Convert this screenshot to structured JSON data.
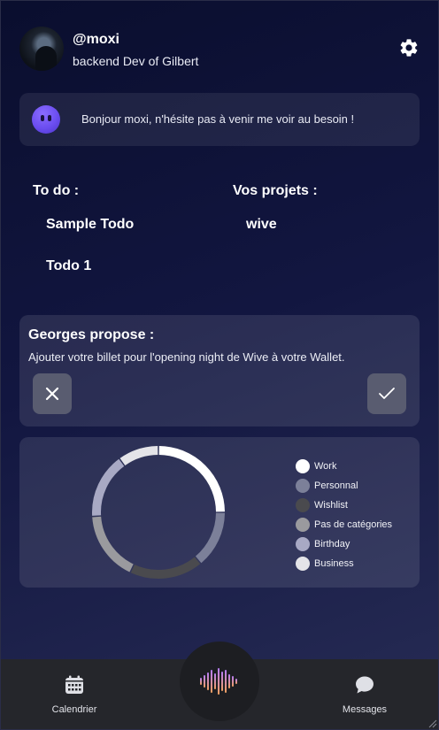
{
  "profile": {
    "username": "@moxi",
    "subtitle": "backend Dev of Gilbert",
    "avatar_icon": "avatar-photo",
    "settings_icon": "gear-icon"
  },
  "greeting": {
    "icon": "bot-avatar-icon",
    "text": "Bonjour moxi, n'hésite pas à venir me voir au besoin !"
  },
  "todo": {
    "title": "To do :",
    "items": [
      "Sample Todo",
      "Todo 1"
    ]
  },
  "projects": {
    "title": "Vos projets :",
    "items": [
      "wive"
    ]
  },
  "proposal": {
    "title": "Georges propose :",
    "text": "Ajouter votre billet pour l'opening night de Wive à votre Wallet.",
    "reject_icon": "close-icon",
    "accept_icon": "check-icon"
  },
  "chart_data": {
    "type": "pie",
    "variant": "donut",
    "categories": [
      "Work",
      "Personnal",
      "Wishlist",
      "Pas de catégories",
      "Birthday",
      "Business"
    ],
    "values": [
      25,
      14,
      18,
      17,
      16,
      10
    ],
    "colors": [
      "#ffffff",
      "#7c8099",
      "#4a4a4e",
      "#9a9a9e",
      "#a8a9c4",
      "#e4e4e8"
    ],
    "legend_position": "right"
  },
  "nav": {
    "calendar_label": "Calendrier",
    "messages_label": "Messages",
    "calendar_icon": "calendar-icon",
    "messages_icon": "chat-bubble-icon",
    "center_icon": "sound-wave-icon"
  },
  "colors": {
    "background": "#121640",
    "card": "#ffffff1a",
    "bottom_bar": "#25262b",
    "wave_start": "#c07cf0",
    "wave_end": "#f0a060"
  }
}
